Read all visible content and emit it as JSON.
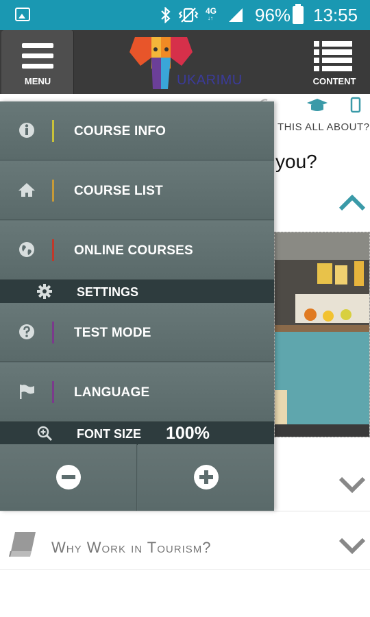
{
  "status_bar": {
    "network": "4G",
    "battery": "96%",
    "time": "13:55",
    "icons": [
      "image-notification-icon",
      "bluetooth-icon",
      "vibrate-icon",
      "signal-icon",
      "battery-icon"
    ]
  },
  "header": {
    "menu_label": "MENU",
    "logo_text": "UKARIMU",
    "content_label": "CONTENT"
  },
  "drawer": {
    "items": [
      {
        "label": "COURSE INFO",
        "icon": "info-icon",
        "accent": "#c9c23a"
      },
      {
        "label": "COURSE LIST",
        "icon": "home-icon",
        "accent": "#c79a38"
      },
      {
        "label": "ONLINE COURSES",
        "icon": "globe-icon",
        "accent": "#c0392b"
      }
    ],
    "settings_label": "SETTINGS",
    "items2": [
      {
        "label": "TEST MODE",
        "icon": "question-icon",
        "accent": "#7b3a8c"
      },
      {
        "label": "LANGUAGE",
        "icon": "flag-icon",
        "accent": "#7b3a8c"
      }
    ],
    "font_size_label": "FONT SIZE",
    "font_size_value": "100%"
  },
  "background_page": {
    "question_line_1": "THIS ALL ABOUT?",
    "question_line_2": "you?",
    "topic_title": "Why Work in Tourism?"
  },
  "colors": {
    "status_bar": "#1a98b2",
    "header": "#3a3a3a",
    "drawer": "#5d6d6e",
    "section_bar": "#2e3c3e",
    "accent_teal": "#3a9aa8"
  }
}
